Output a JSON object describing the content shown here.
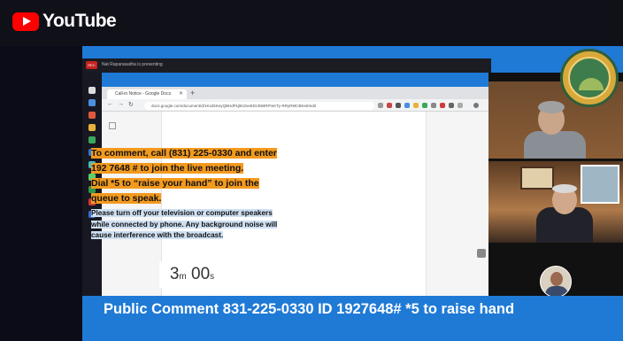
{
  "youtube": {
    "brand": "YouTube"
  },
  "zoom": {
    "rec_label": "REC",
    "presenting_text": "Nat Rapanasatha is presenting"
  },
  "browser": {
    "tab_title": "Call-in Notice - Google Docs",
    "url": "docs.google.com/document/d/1KsZkKeyQBHdFkj0KZxeEtG3NBRPmKTy-RRyRMCBKe8/edit"
  },
  "document": {
    "orange_lines": [
      "To comment, call (831) 225-0330 and enter",
      "192 7648 # to join the live meeting.",
      "Dial *5 to “raise your hand” to join the",
      "queue to speak."
    ],
    "blue_lines": [
      "Please turn off your television or computer speakers",
      "while connected by phone. Any background noise will",
      "cause interference with the broadcast."
    ]
  },
  "timer": {
    "minutes": "3",
    "minutes_unit": "m",
    "seconds": "00",
    "seconds_unit": "s"
  },
  "banner": {
    "text": "Public Comment 831-225-0330 ID 1927648# *5 to raise hand"
  },
  "colors": {
    "frame_blue": "#1f7ad6",
    "highlight_orange": "#f39a1e",
    "youtube_red": "#ff0000"
  },
  "icons": [
    "youtube-logo-icon",
    "city-seal-icon",
    "new-tab-icon",
    "close-tab-icon"
  ]
}
